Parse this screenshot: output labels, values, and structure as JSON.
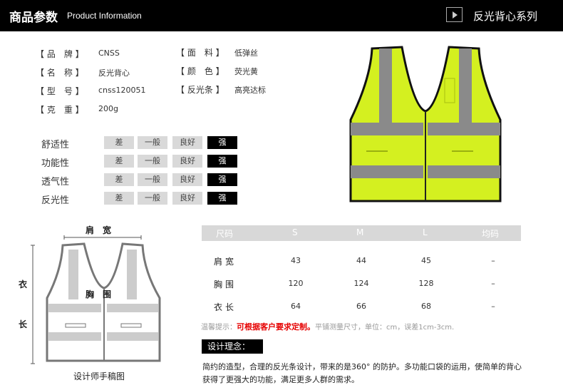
{
  "header": {
    "title": "商品参数",
    "subtitle": "Product Information",
    "series": "反光背心系列"
  },
  "specs": {
    "left": [
      {
        "key": "【 品　牌 】",
        "value": "CNSS"
      },
      {
        "key": "【 名　称 】",
        "value": "反光背心"
      },
      {
        "key": "【 型　号 】",
        "value": "cnss120051"
      },
      {
        "key": "【 克　重 】",
        "value": "200g"
      }
    ],
    "right": [
      {
        "key": "【 面　料 】",
        "value": "低弹丝"
      },
      {
        "key": "【 颜　色 】",
        "value": "荧光黄"
      },
      {
        "key": "【 反光条 】",
        "value": "高亮达标"
      }
    ]
  },
  "ratings": {
    "levels": [
      "差",
      "一般",
      "良好",
      "强"
    ],
    "rows": [
      {
        "label": "舒适性",
        "selected": "强"
      },
      {
        "label": "功能性",
        "selected": "强"
      },
      {
        "label": "透气性",
        "selected": "强"
      },
      {
        "label": "反光性",
        "selected": "强"
      }
    ]
  },
  "size_table": {
    "headers": [
      "尺码",
      "S",
      "M",
      "L",
      "均码"
    ],
    "rows": [
      {
        "label": "肩宽",
        "values": [
          "43",
          "44",
          "45",
          "–"
        ]
      },
      {
        "label": "胸围",
        "values": [
          "120",
          "124",
          "128",
          "–"
        ]
      },
      {
        "label": "衣长",
        "values": [
          "64",
          "66",
          "68",
          "–"
        ]
      }
    ]
  },
  "note": {
    "prefix": "温馨提示：",
    "highlight": "可根据客户要求定制。",
    "suffix": "平铺测量尺寸，单位：cm，误差1cm-3cm."
  },
  "design": {
    "heading": "设计理念：",
    "text": "简约的造型，合理的反光条设计，带来的是360° 的防护。多功能口袋的运用，使简单的背心获得了更强大的功能，满足更多人群的需求。"
  },
  "sketch": {
    "shoulder_label": "肩　宽",
    "chest_label": "胸　围",
    "length_label_top": "衣",
    "length_label_bottom": "长",
    "caption": "设计师手稿图"
  },
  "colors": {
    "vest": "#d4f020",
    "stripe": "#8a8a8a",
    "piping": "#111111",
    "header_bg": "#000000",
    "note_highlight": "#e60000"
  }
}
